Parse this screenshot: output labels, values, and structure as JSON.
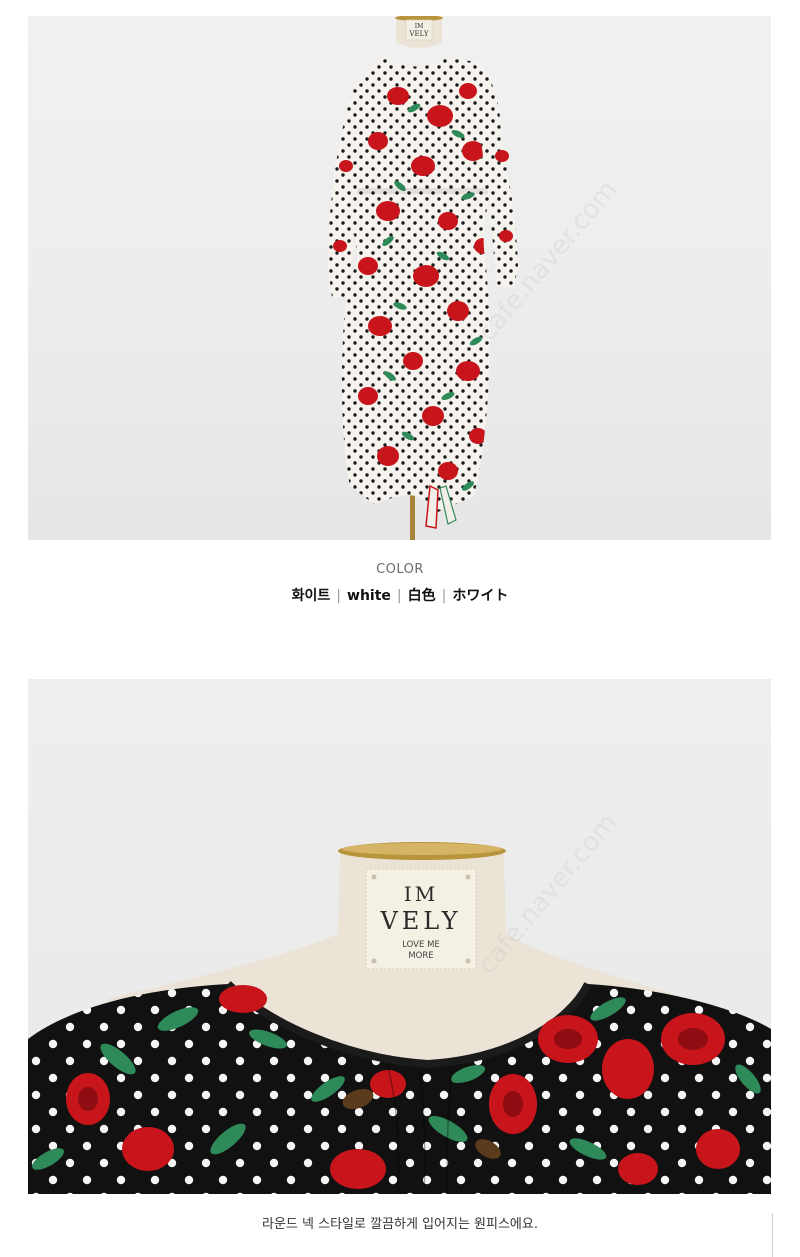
{
  "photos": {
    "top_label_line1": "IM",
    "top_label_line2": "VELY",
    "bottom_label_line1": "IM",
    "bottom_label_line2": "VELY",
    "bottom_label_line3": "LOVE ME",
    "bottom_label_line4": "MORE"
  },
  "color_section": {
    "heading": "COLOR",
    "names": [
      "화이트",
      "white",
      "白色",
      "ホワイト"
    ],
    "separator": "|"
  },
  "description": "라운드 넥 스타일로 깔끔하게 입어지는 원피스에요.",
  "colors": {
    "background": "#ffffff",
    "print_red": "#c8141b",
    "print_green": "#2f8a5a",
    "dress_black": "#111111",
    "dress_white": "#f6f3ee",
    "mannequin_linen": "#ebe4d6",
    "gold": "#b8953c"
  }
}
